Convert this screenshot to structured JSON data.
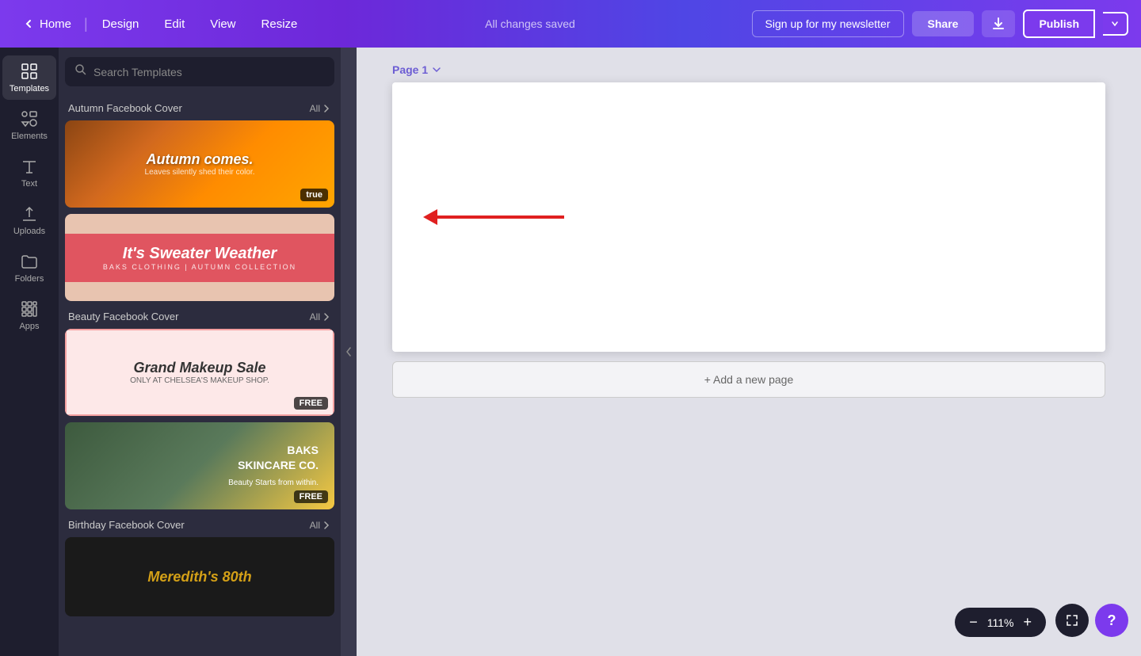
{
  "topnav": {
    "home_label": "Home",
    "design_label": "Design",
    "edit_label": "Edit",
    "view_label": "View",
    "resize_label": "Resize",
    "saved_status": "All changes saved",
    "newsletter_label": "Sign up for my newsletter",
    "share_label": "Share",
    "publish_label": "Publish"
  },
  "sidebar": {
    "items": [
      {
        "id": "templates",
        "label": "Templates",
        "icon": "grid-icon"
      },
      {
        "id": "elements",
        "label": "Elements",
        "icon": "elements-icon"
      },
      {
        "id": "text",
        "label": "Text",
        "icon": "text-icon"
      },
      {
        "id": "uploads",
        "label": "Uploads",
        "icon": "upload-icon"
      },
      {
        "id": "folders",
        "label": "Folders",
        "icon": "folder-icon"
      },
      {
        "id": "apps",
        "label": "Apps",
        "icon": "apps-icon"
      }
    ]
  },
  "search": {
    "placeholder": "Search Templates"
  },
  "template_sections": [
    {
      "id": "autumn",
      "title": "Autumn Facebook Cover",
      "all_label": "All",
      "templates": [
        {
          "id": "autumn-comes",
          "title": "Autumn comes.",
          "subtitle": "Leaves silently shed their color.",
          "free": true,
          "type": "autumn"
        },
        {
          "id": "sweater-weather",
          "title": "It's Sweater Weather",
          "subtitle": "BAKS CLOTHING | AUTUMN COLLECTION",
          "free": false,
          "type": "sweater"
        }
      ]
    },
    {
      "id": "beauty",
      "title": "Beauty Facebook Cover",
      "all_label": "All",
      "templates": [
        {
          "id": "makeup-sale",
          "title": "Grand Makeup Sale",
          "subtitle": "ONLY AT CHELSEA'S MAKEUP SHOP.",
          "free": true,
          "type": "makeup"
        },
        {
          "id": "skincare",
          "title": "BAKS SKINCARE CO.",
          "subtitle": "Beauty Starts from within.",
          "free": true,
          "type": "skincare"
        }
      ]
    },
    {
      "id": "birthday",
      "title": "Birthday Facebook Cover",
      "all_label": "All",
      "templates": [
        {
          "id": "meredith",
          "title": "Meredith's 80th",
          "free": false,
          "type": "birthday"
        }
      ]
    }
  ],
  "canvas": {
    "page_label": "Page 1",
    "add_page_label": "+ Add a new page"
  },
  "zoom": {
    "level": "111%",
    "minus_label": "−",
    "plus_label": "+"
  },
  "help": {
    "label": "?"
  }
}
